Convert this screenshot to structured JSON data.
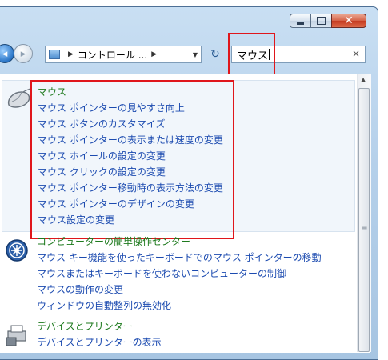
{
  "window": {
    "caption_buttons": {
      "minimize": "minimize-icon",
      "maximize": "maximize-icon",
      "close": "✕"
    }
  },
  "toolbar": {
    "back_glyph": "◂",
    "fwd_glyph": "▸",
    "breadcrumb": "コントロール ...",
    "refresh_glyph": "↻"
  },
  "search": {
    "value": "マウス",
    "clear_glyph": "×"
  },
  "results": [
    {
      "title": "マウス",
      "icon": "mouse-icon",
      "links": [
        "マウス ポインターの見やすさ向上",
        "マウス ボタンのカスタマイズ",
        "マウス ポインターの表示または速度の変更",
        "マウス ホイールの設定の変更",
        "マウス クリックの設定の変更",
        "マウス ポインター移動時の表示方法の変更",
        "マウス ポインターのデザインの変更",
        "マウス設定の変更"
      ]
    },
    {
      "title": "コンピューターの簡単操作センター",
      "icon": "ease-of-access-icon",
      "links": [
        "マウス キー機能を使ったキーボードでのマウス ポインターの移動",
        "マウスまたはキーボードを使わないコンピューターの制御",
        "マウスの動作の変更",
        "ウィンドウの自動整列の無効化"
      ]
    },
    {
      "title": "デバイスとプリンター",
      "icon": "printer-icon",
      "links": [
        "デバイスとプリンターの表示"
      ]
    }
  ],
  "colors": {
    "title": "#1e7a1e",
    "link": "#1c4bb0",
    "highlight": "#e0161b"
  }
}
